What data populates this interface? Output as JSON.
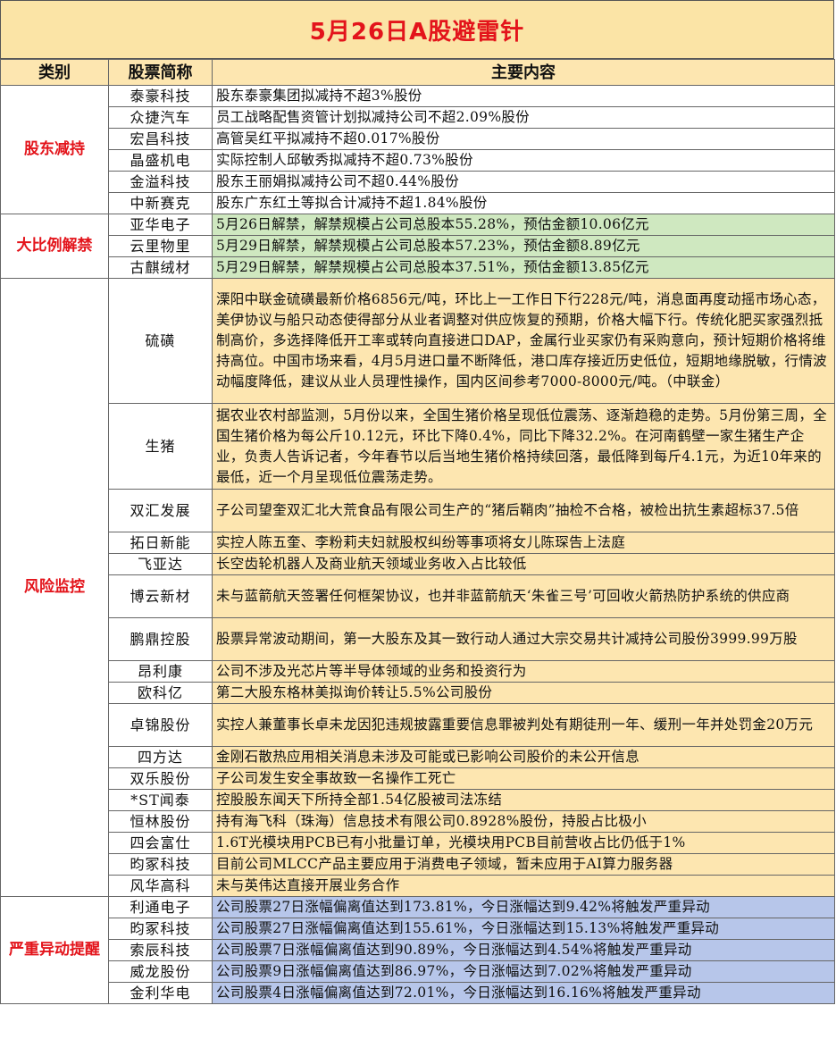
{
  "title": "5月26日A股避雷针",
  "header": {
    "category": "类别",
    "stock": "股票简称",
    "content": "主要内容"
  },
  "groups": [
    {
      "category": "股东减持",
      "rows": [
        {
          "name": "泰豪科技",
          "text": "股东泰豪集团拟减持不超3%股份"
        },
        {
          "name": "众捷汽车",
          "text": "员工战略配售资管计划拟减持公司不超2.09%股份"
        },
        {
          "name": "宏昌科技",
          "text": "高管吴红平拟减持不超0.017%股份"
        },
        {
          "name": "晶盛机电",
          "text": "实际控制人邱敏秀拟减持不超0.73%股份"
        },
        {
          "name": "金溢科技",
          "text": "股东王丽娟拟减持公司不超0.44%股份"
        },
        {
          "name": "中新赛克",
          "text": "股东广东红土等拟合计减持不超1.84%股份"
        }
      ]
    },
    {
      "category": "大比例解禁",
      "rows": [
        {
          "name": "亚华电子",
          "text": "5月26日解禁，解禁规模占公司总股本55.28%，预估金额10.06亿元"
        },
        {
          "name": "云里物里",
          "text": "5月29日解禁，解禁规模占公司总股本57.23%，预估金额8.89亿元"
        },
        {
          "name": "古麒绒材",
          "text": "5月29日解禁，解禁规模占公司总股本37.51%，预估金额13.85亿元"
        }
      ]
    },
    {
      "category": "风险监控",
      "rows": [
        {
          "name": "硫磺",
          "text": "溧阳中联金硫磺最新价格6856元/吨，环比上一工作日下行228元/吨，消息面再度动摇市场心态，美伊协议与船只动态使得部分从业者调整对供应恢复的预期，价格大幅下行。传统化肥买家强烈抵制高价，多选择降低开工率或转向直接进口DAP，金属行业买家仍有采购意向，预计短期价格将维持高位。中国市场来看，4月5月进口量不断降低，港口库存接近历史低位，短期地缘脱敏，行情波动幅度降低，建议从业人员理性操作，国内区间参考7000-8000元/吨。（中联金）"
        },
        {
          "name": "生猪",
          "text": "据农业农村部监测，5月份以来，全国生猪价格呈现低位震荡、逐渐趋稳的走势。5月份第三周，全国生猪价格为每公斤10.12元，环比下降0.4%，同比下降32.2%。在河南鹤壁一家生猪生产企业，负责人告诉记者，今年春节以后当地生猪价格持续回落，最低降到每斤4.1元，为近10年来的最低，近一个月呈现低位震荡走势。"
        },
        {
          "name": "双汇发展",
          "text": "子公司望奎双汇北大荒食品有限公司生产的“猪后鞘肉”抽检不合格，被检出抗生素超标37.5倍"
        },
        {
          "name": "拓日新能",
          "text": "实控人陈五奎、李粉莉夫妇就股权纠纷等事项将女儿陈琛告上法庭"
        },
        {
          "name": "飞亚达",
          "text": "长空齿轮机器人及商业航天领域业务收入占比较低"
        },
        {
          "name": "博云新材",
          "text": "未与蓝箭航天签署任何框架协议，也并非蓝箭航天‘朱雀三号’可回收火箭热防护系统的供应商"
        },
        {
          "name": "鹏鼎控股",
          "text": "股票异常波动期间，第一大股东及其一致行动人通过大宗交易共计减持公司股份3999.99万股"
        },
        {
          "name": "昂利康",
          "text": "公司不涉及光芯片等半导体领域的业务和投资行为"
        },
        {
          "name": "欧科亿",
          "text": "第二大股东格林美拟询价转让5.5%公司股份"
        },
        {
          "name": "卓锦股份",
          "text": "实控人兼董事长卓未龙因犯违规披露重要信息罪被判处有期徒刑一年、缓刑一年并处罚金20万元"
        },
        {
          "name": "四方达",
          "text": "金刚石散热应用相关消息未涉及可能或已影响公司股价的未公开信息"
        },
        {
          "name": "双乐股份",
          "text": "子公司发生安全事故致一名操作工死亡"
        },
        {
          "name": "*ST闻泰",
          "text": "控股股东闻天下所持全部1.54亿股被司法冻结"
        },
        {
          "name": "恒林股份",
          "text": "持有海飞科（珠海）信息技术有限公司0.8928%股份，持股占比极小"
        },
        {
          "name": "四会富仕",
          "text": "1.6T光模块用PCB已有小批量订单，光模块用PCB目前营收占比仍低于1%"
        },
        {
          "name": "昀冢科技",
          "text": "目前公司MLCC产品主要应用于消费电子领域，暂未应用于AI算力服务器"
        },
        {
          "name": "风华高科",
          "text": "未与英伟达直接开展业务合作"
        }
      ]
    },
    {
      "category": "严重异动提醒",
      "rows": [
        {
          "name": "利通电子",
          "text": "公司股票27日涨幅偏离值达到173.81%，今日涨幅达到9.42%将触发严重异动"
        },
        {
          "name": "昀冢科技",
          "text": "公司股票27日涨幅偏离值达到155.61%，今日涨幅达到15.13%将触发严重异动"
        },
        {
          "name": "索辰科技",
          "text": "公司股票7日涨幅偏离值达到90.89%，今日涨幅达到4.54%将触发严重异动"
        },
        {
          "name": "威龙股份",
          "text": "公司股票9日涨幅偏离值达到86.97%，今日涨幅达到7.02%将触发严重异动"
        },
        {
          "name": "金利华电",
          "text": "公司股票4日涨幅偏离值达到72.01%，今日涨幅达到16.16%将触发严重异动"
        }
      ]
    }
  ]
}
